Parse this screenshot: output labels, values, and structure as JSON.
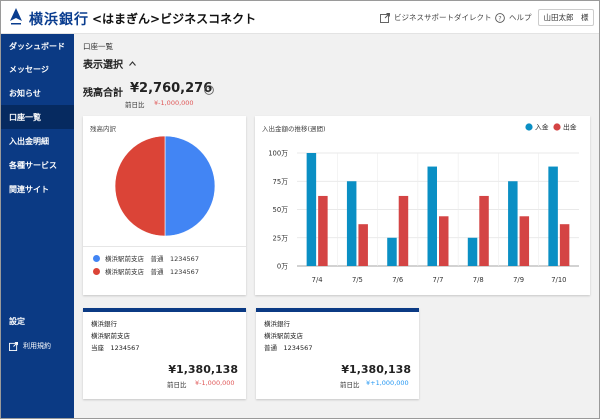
{
  "header": {
    "bank_name": "横浜銀行",
    "service_name": "<はまぎん>ビジネスコネクト",
    "links": [
      {
        "label": "ビジネスサポートダイレクト",
        "icon": "external-link-icon"
      },
      {
        "label": "ヘルプ",
        "icon": "help-circle-icon"
      }
    ],
    "user_label": "山田太郎　様"
  },
  "sidebar": {
    "items": [
      {
        "label": "ダッシュボード",
        "active": false
      },
      {
        "label": "メッセージ",
        "active": false
      },
      {
        "label": "お知らせ",
        "active": false
      },
      {
        "label": "口座一覧",
        "active": true
      },
      {
        "label": "入出金明細",
        "active": false
      },
      {
        "label": "各種サービス",
        "active": false
      },
      {
        "label": "関連サイト",
        "active": false
      }
    ],
    "settings_label": "設定",
    "terms_label": "利用規約"
  },
  "main": {
    "breadcrumb": "口座一覧",
    "display_select": "表示選択",
    "total_label": "残高合計",
    "total_value": "¥2,760,276",
    "prev_day_label": "前日比",
    "prev_day_value": "¥-1,000,000"
  },
  "breakdown": {
    "title": "残高内訳",
    "legend": [
      {
        "label": "横浜駅前支店　普通　1234567",
        "color": "#4285f4"
      },
      {
        "label": "横浜駅前支店　普通　1234567",
        "color": "#db4437"
      }
    ]
  },
  "colors": {
    "primary": "#0b3a84",
    "deposit": "#0a8fc4",
    "withdrawal": "#d44444",
    "negative": "#e05757",
    "positive": "#2196f3"
  },
  "chart_data": [
    {
      "type": "pie",
      "labels": [
        "横浜駅前支店　普通　1234567",
        "横浜駅前支店　普通　1234567"
      ],
      "values": [
        50,
        50
      ],
      "colors": [
        "#4285f4",
        "#db4437"
      ]
    },
    {
      "type": "bar",
      "title": "入出金額の推移(週間)",
      "categories": [
        "7/4",
        "7/5",
        "7/6",
        "7/7",
        "7/8",
        "7/9",
        "7/10"
      ],
      "series": [
        {
          "name": "入金",
          "values": [
            100,
            75,
            25,
            88,
            25,
            75,
            88
          ]
        },
        {
          "name": "出金",
          "values": [
            62,
            37,
            62,
            44,
            62,
            44,
            37
          ]
        }
      ],
      "y_ticks": [
        "0万",
        "25万",
        "50万",
        "75万",
        "100万"
      ],
      "ylim": [
        0,
        100
      ],
      "grid": true,
      "legend_position": "top-right"
    }
  ],
  "accounts": [
    {
      "bank": "横浜銀行",
      "branch": "横浜駅前支店",
      "account": "当座　1234567",
      "balance": "¥1,380,138",
      "prev_label": "前日比",
      "prev_value": "¥-1,000,000",
      "prev_color": "#e05757"
    },
    {
      "bank": "横浜銀行",
      "branch": "横浜駅前支店",
      "account": "普通　1234567",
      "balance": "¥1,380,138",
      "prev_label": "前日比",
      "prev_value": "¥+1,000,000",
      "prev_color": "#2196f3"
    }
  ]
}
